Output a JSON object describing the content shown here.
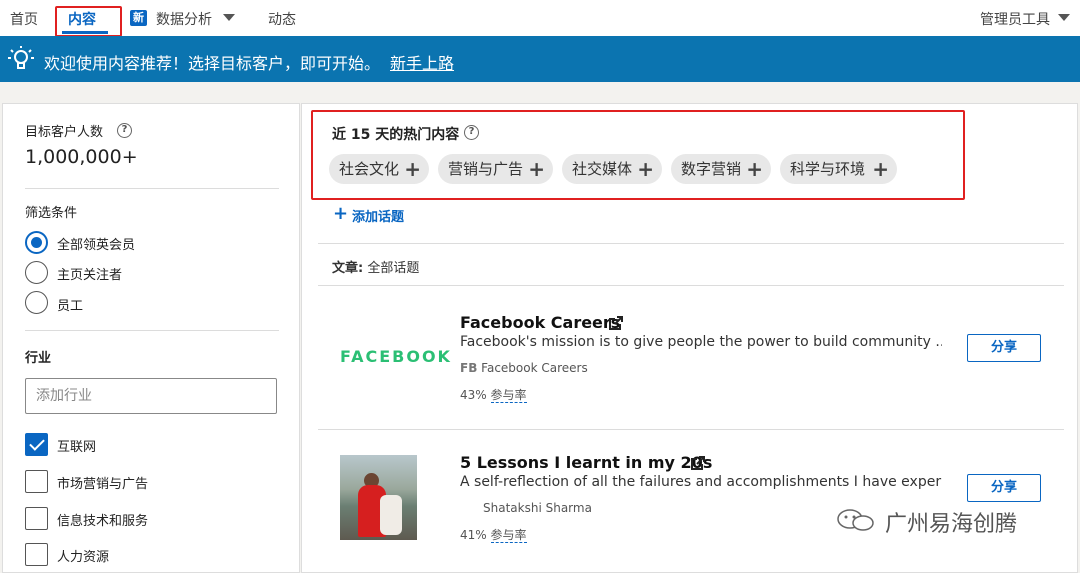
{
  "topnav": {
    "home": "首页",
    "content": "内容",
    "new_badge": "新",
    "analytics": "数据分析",
    "activity": "动态",
    "admin_tools": "管理员工具"
  },
  "banner": {
    "text": "欢迎使用内容推荐！选择目标客户，即可开始。",
    "link": "新手上路"
  },
  "left": {
    "audience_label": "目标客户人数",
    "audience_count": "1,000,000+",
    "filter_label": "筛选条件",
    "filters": [
      "全部领英会员",
      "主页关注者",
      "员工"
    ],
    "industry_label": "行业",
    "industry_placeholder": "添加行业",
    "industries": [
      "互联网",
      "市场营销与广告",
      "信息技术和服务",
      "人力资源"
    ]
  },
  "trending": {
    "title": "近 15 天的热门内容",
    "topics": [
      "社会文化",
      "营销与广告",
      "社交媒体",
      "数字营销",
      "科学与环境"
    ],
    "add_topic": "添加话题"
  },
  "articles": {
    "label": "文章:",
    "filter": "全部话题",
    "items": [
      {
        "title": "Facebook Careers",
        "desc": "Facebook's mission is to give people the power to build community ...",
        "source_prefix": "FB",
        "source": "Facebook Careers",
        "logo": "FACEBOOK",
        "rate": "43%",
        "rate_label": "参与率",
        "share": "分享"
      },
      {
        "title": "5 Lessons I learnt in my 20s",
        "desc": "A self-reflection of all the failures and accomplishments I have experi...",
        "source": "Shatakshi Sharma",
        "rate": "41%",
        "rate_label": "参与率",
        "share": "分享"
      }
    ]
  },
  "watermark": "广州易海创腾",
  "colors": {
    "accent": "#0a66c2",
    "banner": "#0b74b0",
    "highlight_box": "#e02020",
    "facebook_logo": "#2bbf74"
  }
}
